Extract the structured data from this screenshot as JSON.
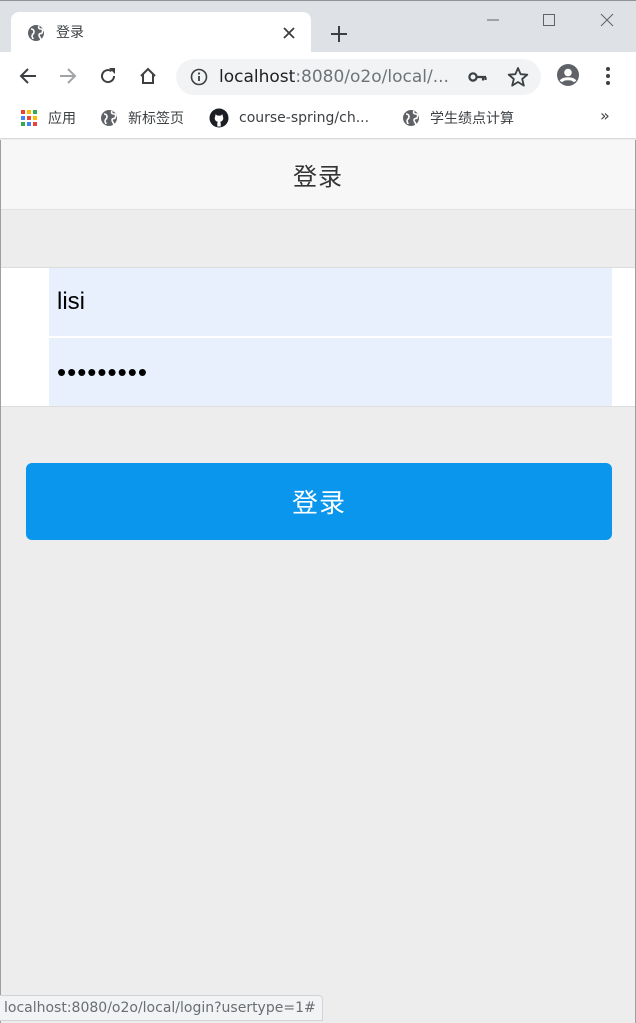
{
  "browser": {
    "tab": {
      "title": "登录",
      "favicon": "globe-icon",
      "close": "close-icon"
    },
    "newtab": "plus-icon",
    "window_controls": [
      "minimize-icon",
      "maximize-icon",
      "close-icon"
    ],
    "nav": [
      "back-icon",
      "forward-icon",
      "reload-icon",
      "home-icon"
    ],
    "url_host": "localhost",
    "url_rest": ":8080/o2o/local/...",
    "bookmarks": [
      {
        "label": "应用",
        "icon": "apps-grid-icon"
      },
      {
        "label": "新标签页",
        "icon": "globe-icon"
      },
      {
        "label": "course-spring/ch...",
        "icon": "github-icon"
      },
      {
        "label": "学生绩点计算",
        "icon": "globe-icon"
      }
    ],
    "bookmarks_more": "»"
  },
  "page": {
    "title": "登录",
    "username_value": "lisi",
    "password_value": "•••••••••",
    "login_button": "登录"
  },
  "status_url": "localhost:8080/o2o/local/login?usertype=1#",
  "colors": {
    "accent": "#0996ec",
    "field_bg": "#e8effd",
    "page_bg": "#ededed"
  }
}
